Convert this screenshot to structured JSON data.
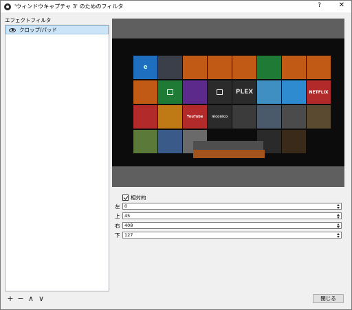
{
  "window": {
    "title": "'ウィンドウキャプチャ 3' のためのフィルタ",
    "help": "?",
    "close": "✕"
  },
  "filters": {
    "label": "エフェクトフィルタ",
    "items": [
      {
        "name": "クロップ/パッド",
        "visible_icon": "eye-icon"
      }
    ]
  },
  "list_tools": {
    "add": "+",
    "remove": "−",
    "up": "∧",
    "down": "∨"
  },
  "settings": {
    "relative_label": "相対的",
    "relative_checked": true,
    "fields": [
      {
        "label": "左",
        "value": "0"
      },
      {
        "label": "上",
        "value": "45"
      },
      {
        "label": "右",
        "value": "408"
      },
      {
        "label": "下",
        "value": "127"
      }
    ]
  },
  "preview": {
    "tile_texts": [
      "PLEX",
      "NETFLIX",
      "niconico",
      "YouTube"
    ]
  },
  "footer": {
    "close_button": "閉じる"
  },
  "colors": {
    "preview_background": "#5f5f5f",
    "preview_content": "#0c0c0c",
    "tile_orange": "#c05a15",
    "tile_green": "#1f7a36",
    "tile_red": "#b32a2a",
    "selection": "#cce4f7"
  }
}
